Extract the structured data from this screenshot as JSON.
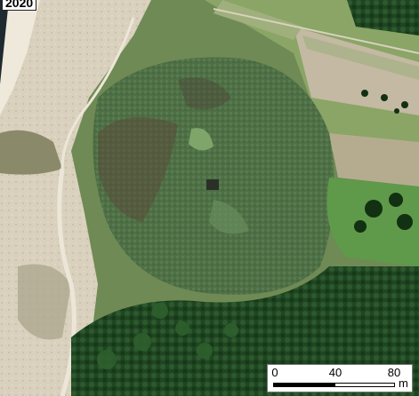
{
  "map": {
    "year": "2020",
    "scale": {
      "labels": [
        "0",
        "40",
        "80"
      ],
      "unit": "m"
    }
  }
}
